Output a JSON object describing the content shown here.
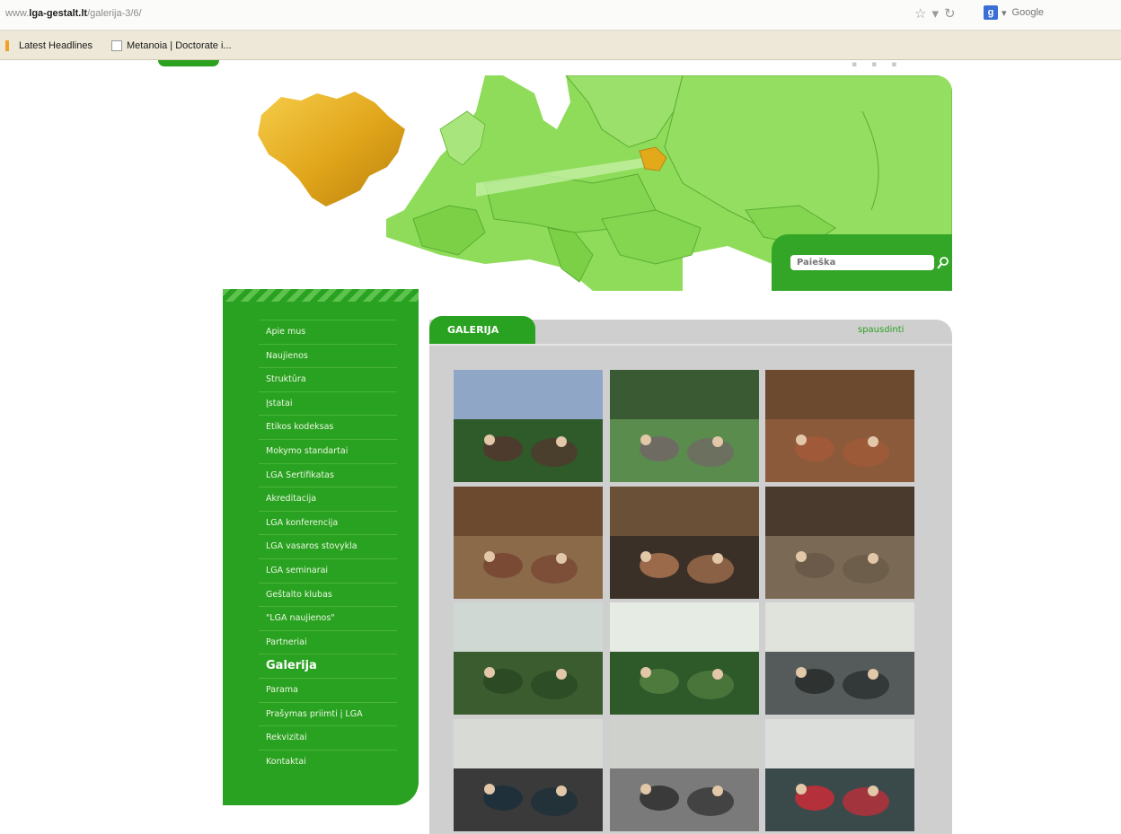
{
  "browser": {
    "url_prefix": "www.",
    "url_domain": "lga-gestalt.lt",
    "url_path": "/galerija-3/6/",
    "search_engine_label": "Google",
    "bookmarks": [
      "Latest Headlines",
      "Metanoia | Doctorate i..."
    ]
  },
  "search": {
    "placeholder": "Paieška"
  },
  "sidebar": {
    "items": [
      "Apie mus",
      "Naujienos",
      "Struktūra",
      "Įstatai",
      "Etikos kodeksas",
      "Mokymo standartai",
      "LGA Sertifikatas",
      "Akreditacija",
      "LGA konferencija",
      "LGA vasaros stovykla",
      "LGA seminarai",
      "Geštalto klubas",
      "\"LGA naujienos\"",
      "Partneriai",
      "Galerija",
      "Parama",
      "Prašymas priimti į LGA",
      "Rekvizitai",
      "Kontaktai"
    ],
    "active": "Galerija"
  },
  "gallery": {
    "title": "GALERIJA",
    "back_link": "spausdinti"
  },
  "colors": {
    "brand_green": "#2aa221",
    "map_green": "#8fdc5a",
    "lithuania_gold": "#e2aa1a",
    "gallery_bg": "#cfcfcf"
  }
}
